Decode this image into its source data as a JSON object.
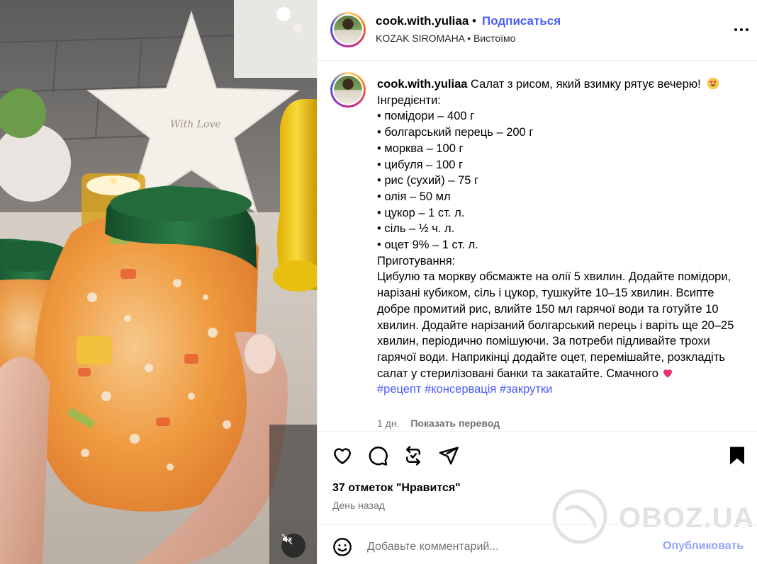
{
  "post": {
    "username": "cook.with.yuliaa",
    "dot": "•",
    "follow_label": "Подписаться",
    "audio_artist": "KOZAK SIROMAHA",
    "audio_track": "Вистоїмо"
  },
  "caption": {
    "username": "cook.with.yuliaa",
    "lines": [
      "Салат з рисом, який взимку рятує вечерю!",
      "Інгредієнти:",
      "• помідори – 400 г",
      "• болгарський перець – 200 г",
      "• морква – 100 г",
      "• цибуля – 100 г",
      "• рис (сухий) – 75 г",
      "• олія – 50 мл",
      "• цукор – 1 ст. л.",
      "• сіль – ½ ч. л.",
      "• оцет 9% – 1 ст. л.",
      "Приготування:"
    ],
    "method": "Цибулю та моркву обсмажте на олії 5 хвилин. Додайте помідори, нарізані кубиком, сіль і цукор, тушкуйте 10–15 хвилин. Всипте добре промитий рис, влийте 150 мл гарячої води та готуйте 10 хвилин. Додайте нарізаний болгарський перець і варіть ще 20–25 хвилин, періодично помішуючи. За потреби підливайте трохи гарячої води. Наприкінці додайте оцет, перемішайте, розкладіть салат у стерилізовані банки та закатайте. Смачного",
    "hashtags": [
      "#рецепт",
      "#консервація",
      "#закрутки"
    ],
    "age": "1 дн.",
    "translate_label": "Показать перевод"
  },
  "actions": {
    "likes_text": "37 отметок \"Нравится\"",
    "posted_text": "День назад"
  },
  "comment": {
    "placeholder": "Добавьте комментарий...",
    "publish_label": "Опубликовать"
  },
  "watermark": {
    "text": "OBOZ.UA"
  },
  "colors": {
    "link": "#4a5df9",
    "publish_disabled": "#94a2fb",
    "heart_emoji": "#e8336f",
    "muted_text": "#737373",
    "jar_lid": "#1f6a3a"
  },
  "icons": [
    "more-icon",
    "like-icon",
    "comment-icon",
    "repost-icon",
    "share-icon",
    "save-icon",
    "emoji-icon",
    "mute-icon",
    "heart-eyes-emoji",
    "heart-emoji"
  ]
}
